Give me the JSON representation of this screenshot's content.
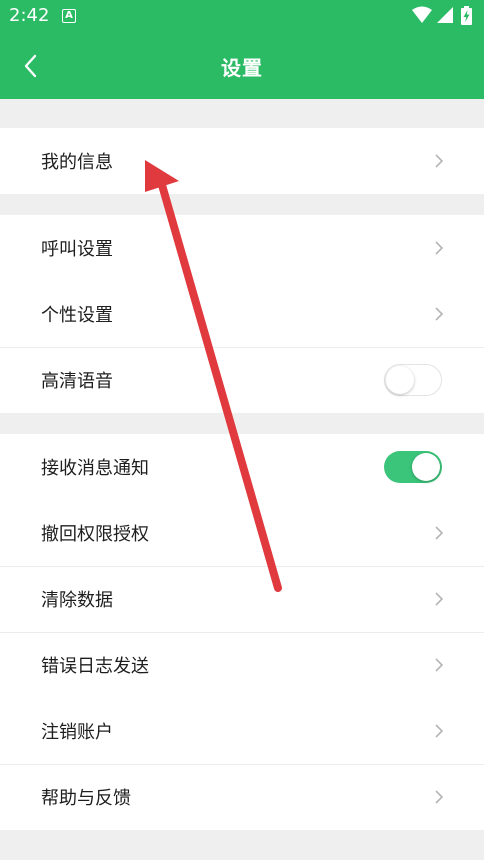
{
  "status_bar": {
    "time": "2:42",
    "notification_icon": "A",
    "icons": [
      "wifi-icon",
      "signal-icon",
      "battery-charging-icon"
    ]
  },
  "header": {
    "title": "设置",
    "back_icon": "chevron-left-icon",
    "background_color": "#2bbb64"
  },
  "groups": [
    {
      "items": [
        {
          "label": "我的信息",
          "type": "link"
        }
      ]
    },
    {
      "items": [
        {
          "label": "呼叫设置",
          "type": "link"
        },
        {
          "label": "个性设置",
          "type": "link"
        },
        {
          "label": "高清语音",
          "type": "toggle",
          "checked": false
        }
      ]
    },
    {
      "items": [
        {
          "label": "接收消息通知",
          "type": "toggle",
          "checked": true
        },
        {
          "label": "撤回权限授权",
          "type": "link"
        },
        {
          "label": "清除数据",
          "type": "link"
        },
        {
          "label": "错误日志发送",
          "type": "link"
        },
        {
          "label": "注销账户",
          "type": "link"
        },
        {
          "label": "帮助与反馈",
          "type": "link"
        }
      ]
    }
  ],
  "colors": {
    "toggle_on": "#3bc57a",
    "annotation_arrow": "#e0393e"
  }
}
